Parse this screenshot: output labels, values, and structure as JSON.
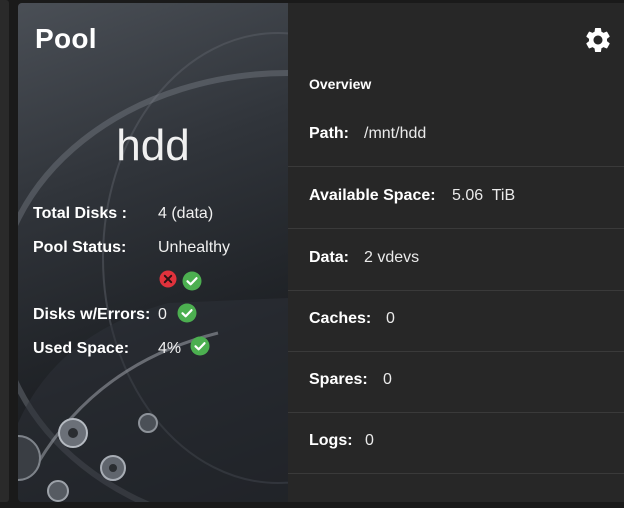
{
  "pool_card": {
    "title": "Pool",
    "pool_name": "hdd",
    "stats": {
      "total_disks_label": "Total Disks :",
      "total_disks_value": "4 (data)",
      "pool_status_label": "Pool Status:",
      "pool_status_value": "Unhealthy",
      "disks_errors_label": "Disks w/Errors:",
      "disks_errors_value": "0",
      "used_space_label": "Used Space:",
      "used_space_value": "4%"
    },
    "settings_icon": "gear-icon",
    "status_icons": [
      "error-circle-icon",
      "check-circle-icon"
    ],
    "colors": {
      "error": "#e0323c",
      "ok": "#4caf50",
      "accent": "#ffffff"
    }
  },
  "overview": {
    "heading": "Overview",
    "rows": [
      {
        "label": "Path:",
        "value": "/mnt/hdd"
      },
      {
        "label": "Available Space:",
        "value": "5.06  TiB"
      },
      {
        "label": "Data:",
        "value": "2 vdevs"
      },
      {
        "label": "Caches:",
        "value": "0"
      },
      {
        "label": "Spares:",
        "value": "0"
      },
      {
        "label": "Logs:",
        "value": "0"
      }
    ]
  }
}
